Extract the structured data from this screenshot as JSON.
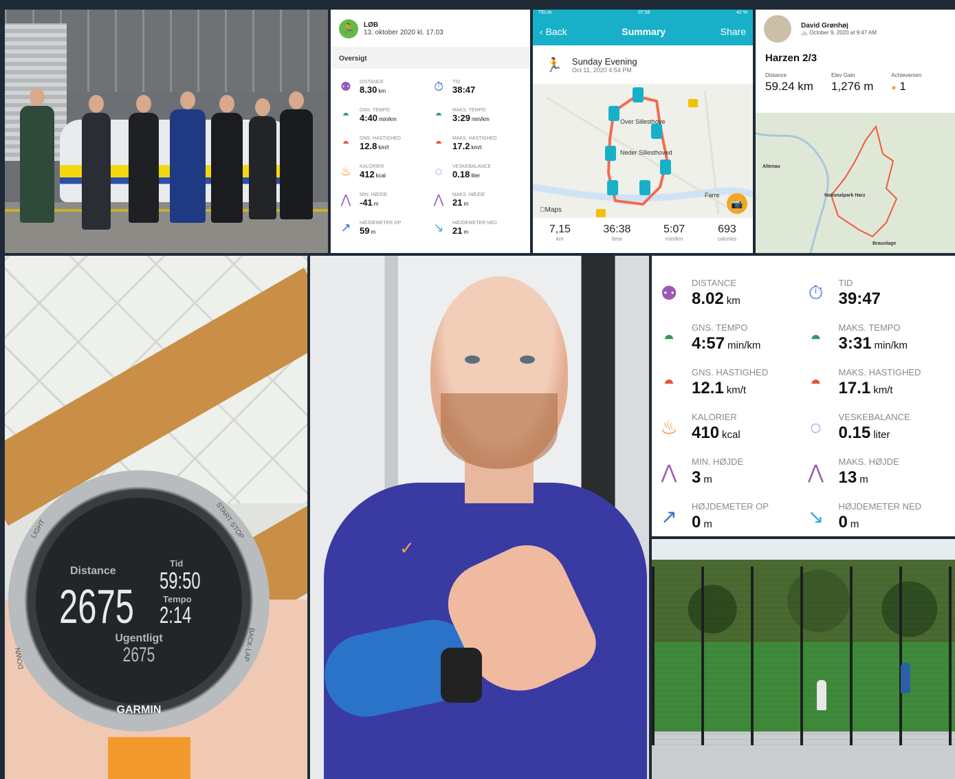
{
  "colors": {
    "page_background": "#1f2a37",
    "run_accent": "#68b848",
    "summary_accent": "#18b0c8",
    "route": "#f26b4f",
    "camera_button": "#f6a61f",
    "achievement": "#f2a33a"
  },
  "run_app": {
    "activity": "LØB",
    "date": "13. oktober 2020 kl. 17.03",
    "section_title": "Oversigt",
    "icon": "runner-icon",
    "stats": [
      {
        "icon": "location-pins-icon",
        "color": "#9b59b6",
        "label": "DISTANCE",
        "value": "8.30",
        "unit": "km"
      },
      {
        "icon": "stopwatch-icon",
        "color": "#3b6fc9",
        "label": "TID",
        "value": "38:47",
        "unit": ""
      },
      {
        "icon": "speedometer-icon",
        "color": "#2e9e5b",
        "label": "GNS. TEMPO",
        "value": "4:40",
        "unit": "min/km"
      },
      {
        "icon": "speedometer-icon",
        "color": "#2e9e5b",
        "label": "MAKS. TEMPO",
        "value": "3:29",
        "unit": "min/km"
      },
      {
        "icon": "speedometer-icon",
        "color": "#e5533d",
        "label": "GNS. HASTIGHED",
        "value": "12.8",
        "unit": "km/t"
      },
      {
        "icon": "speedometer-icon",
        "color": "#e5533d",
        "label": "MAKS. HASTIGHED",
        "value": "17.2",
        "unit": "km/t"
      },
      {
        "icon": "flame-icon",
        "color": "#f0892b",
        "label": "KALORIER",
        "value": "412",
        "unit": "kcal"
      },
      {
        "icon": "water-drops-icon",
        "color": "#3b6fc9",
        "label": "VESKEBALANCE",
        "value": "0.18",
        "unit": "liter"
      },
      {
        "icon": "mountain-icon",
        "color": "#9b59b6",
        "label": "MIN. HØJDE",
        "value": "-41",
        "unit": "m"
      },
      {
        "icon": "mountain-icon",
        "color": "#9b59b6",
        "label": "MAKS. HØJDE",
        "value": "21",
        "unit": "m"
      },
      {
        "icon": "ascent-icon",
        "color": "#3b6fc9",
        "label": "HØJDEMETER OP",
        "value": "59",
        "unit": "m"
      },
      {
        "icon": "descent-icon",
        "color": "#3ba9d9",
        "label": "HØJDEMETER NED",
        "value": "21",
        "unit": "m"
      }
    ]
  },
  "summary_app": {
    "status_left": "TELIA",
    "status_time": "07:58",
    "status_right": "42 %",
    "back": "Back",
    "title": "Summary",
    "share": "Share",
    "activity_title": "Sunday Evening",
    "activity_date": "Oct 11, 2020 4:54 PM",
    "map_places": [
      "Over Sillesthove",
      "Neder Sillesthoved",
      "Farre"
    ],
    "map_attribution": "Maps",
    "totals": [
      {
        "value": "7,15",
        "unit": "km"
      },
      {
        "value": "36:38",
        "unit": "time"
      },
      {
        "value": "5:07",
        "unit": "min/km"
      },
      {
        "value": "693",
        "unit": "calories"
      }
    ]
  },
  "ride_app": {
    "user": "David Grønhøj",
    "date": "October 9, 2020 at 9:47 AM",
    "title": "Harzen 2/3",
    "stats": [
      {
        "label": "Distance",
        "value": "59.24 km"
      },
      {
        "label": "Elev Gain",
        "value": "1,276 m"
      },
      {
        "label": "Achievemen",
        "value": "1"
      }
    ],
    "map_places": [
      "Altenau",
      "Nationalpark Harz",
      "Braunlage"
    ]
  },
  "watch": {
    "distance_label": "Distance",
    "distance_value": "2675",
    "time_label": "Tid",
    "time_value": "59:50",
    "tempo_label": "Tempo",
    "tempo_value": "2:14",
    "weekly_label": "Ugentligt",
    "weekly_value": "2675",
    "brand": "GARMIN",
    "bezel_labels": [
      "LIGHT",
      "START·STOP",
      "BACK·LAP",
      "DOWN"
    ]
  },
  "big_stats": [
    {
      "icon": "location-pins-icon",
      "color": "#9b59b6",
      "label": "DISTANCE",
      "value": "8.02",
      "unit": "km"
    },
    {
      "icon": "stopwatch-icon",
      "color": "#3b6fc9",
      "label": "TID",
      "value": "39:47",
      "unit": ""
    },
    {
      "icon": "speedometer-icon",
      "color": "#2e9e5b",
      "label": "GNS. TEMPO",
      "value": "4:57",
      "unit": "min/km"
    },
    {
      "icon": "speedometer-icon",
      "color": "#2e9e5b",
      "label": "MAKS. TEMPO",
      "value": "3:31",
      "unit": "min/km"
    },
    {
      "icon": "speedometer-icon",
      "color": "#e5533d",
      "label": "GNS. HASTIGHED",
      "value": "12.1",
      "unit": "km/t"
    },
    {
      "icon": "speedometer-icon",
      "color": "#e5533d",
      "label": "MAKS. HASTIGHED",
      "value": "17.1",
      "unit": "km/t"
    },
    {
      "icon": "flame-icon",
      "color": "#f0892b",
      "label": "KALORIER",
      "value": "410",
      "unit": "kcal"
    },
    {
      "icon": "water-drops-icon",
      "color": "#3b6fc9",
      "label": "VESKEBALANCE",
      "value": "0.15",
      "unit": "liter"
    },
    {
      "icon": "mountain-icon",
      "color": "#9b59b6",
      "label": "MIN. HØJDE",
      "value": "3",
      "unit": "m"
    },
    {
      "icon": "mountain-icon",
      "color": "#9b59b6",
      "label": "MAKS. HØJDE",
      "value": "13",
      "unit": "m"
    },
    {
      "icon": "ascent-icon",
      "color": "#3b6fc9",
      "label": "HØJDEMETER OP",
      "value": "0",
      "unit": "m"
    },
    {
      "icon": "descent-icon",
      "color": "#3ba9d9",
      "label": "HØJDEMETER NED",
      "value": "0",
      "unit": "m"
    }
  ]
}
